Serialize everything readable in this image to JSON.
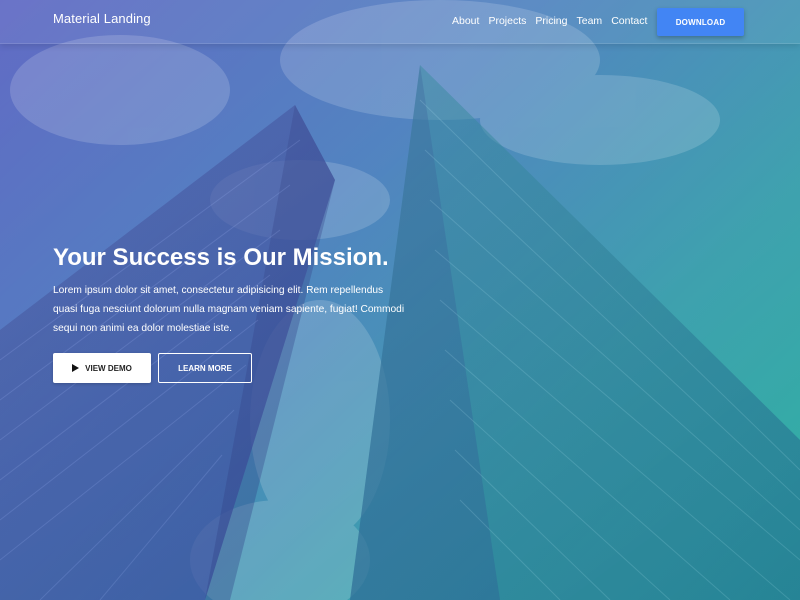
{
  "navbar": {
    "brand": "Material Landing",
    "links": [
      "About",
      "Projects",
      "Pricing",
      "Team",
      "Contact"
    ],
    "download_label": "DOWNLOAD"
  },
  "hero": {
    "headline": "Your Success is Our Mission.",
    "lede": "Lorem ipsum dolor sit amet, consectetur adipisicing elit. Rem repellendus quasi fuga nesciunt dolorum nulla magnam veniam sapiente, fugiat! Commodi sequi non animi ea dolor molestiae iste.",
    "view_demo_label": "VIEW DEMO",
    "learn_more_label": "LEARN MORE",
    "view_demo_icon": "play-icon"
  },
  "colors": {
    "accent": "#4285f4",
    "gradient_start": "#3f4bb8",
    "gradient_end": "#2ab0a0"
  }
}
